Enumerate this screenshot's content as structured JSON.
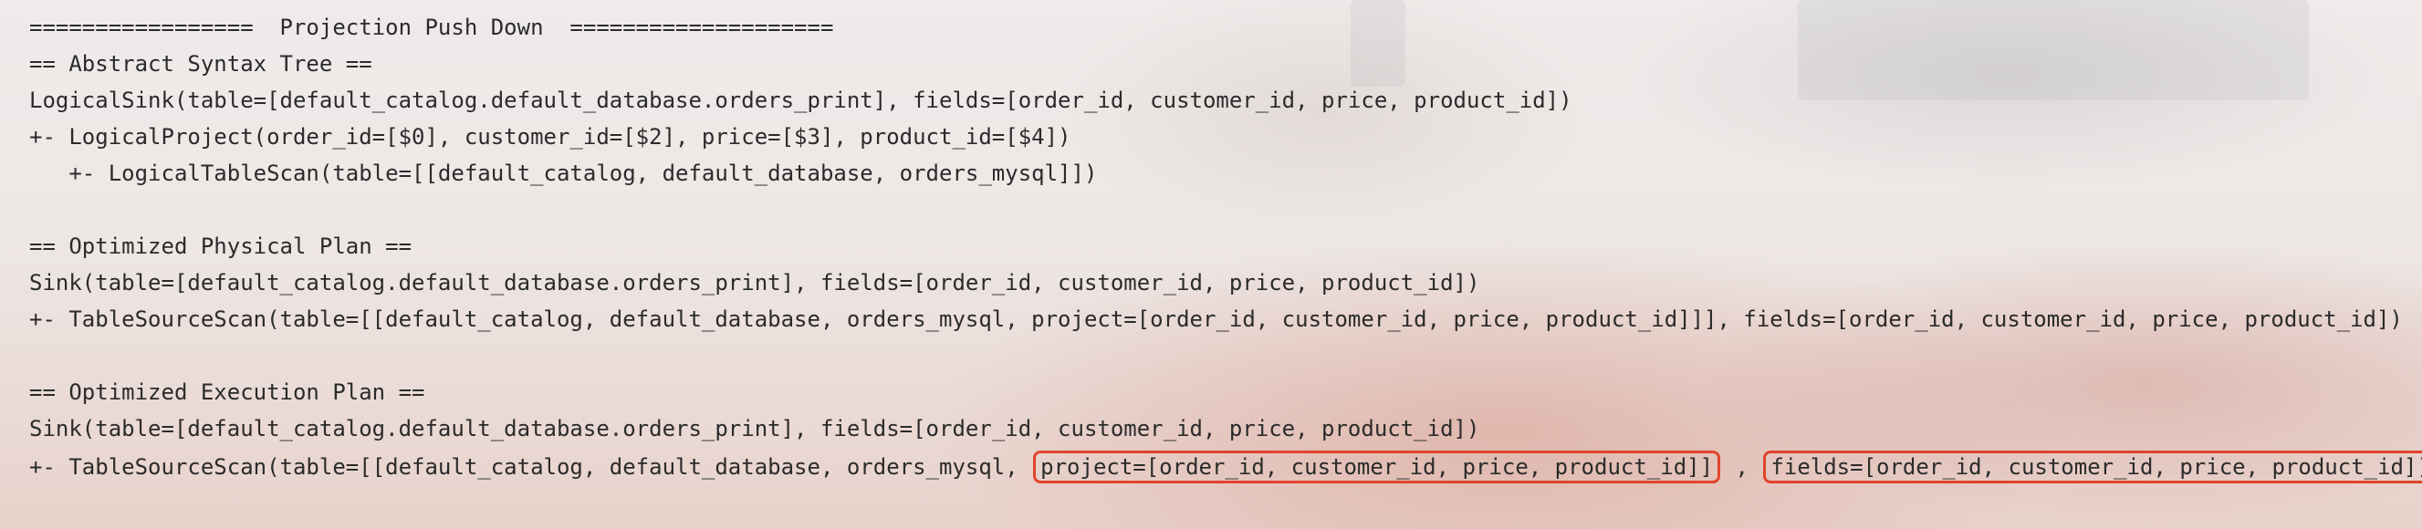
{
  "terminal": {
    "title_line": "=================  Projection Push Down  ====================",
    "ast": {
      "header": "== Abstract Syntax Tree ==",
      "lines": [
        "LogicalSink(table=[default_catalog.default_database.orders_print], fields=[order_id, customer_id, price, product_id])",
        "+- LogicalProject(order_id=[$0], customer_id=[$2], price=[$3], product_id=[$4])",
        "   +- LogicalTableScan(table=[[default_catalog, default_database, orders_mysql]])"
      ]
    },
    "physical": {
      "header": "== Optimized Physical Plan ==",
      "lines": [
        "Sink(table=[default_catalog.default_database.orders_print], fields=[order_id, customer_id, price, product_id])",
        "+- TableSourceScan(table=[[default_catalog, default_database, orders_mysql, project=[order_id, customer_id, price, product_id]]], fields=[order_id, customer_id, price, product_id])"
      ]
    },
    "execution": {
      "header": "== Optimized Execution Plan ==",
      "sink_line": "Sink(table=[default_catalog.default_database.orders_print], fields=[order_id, customer_id, price, product_id])",
      "scan_prefix": "+- TableSourceScan(table=[[default_catalog, default_database, orders_mysql, ",
      "scan_project": "project=[order_id, customer_id, price, product_id]]",
      "scan_sep": " , ",
      "scan_fields": "fields=[order_id, customer_id, price, product_id])"
    }
  },
  "colors": {
    "text": "#2b2b2b",
    "highlight_border": "#e0442c",
    "background": "#eee9e7"
  }
}
